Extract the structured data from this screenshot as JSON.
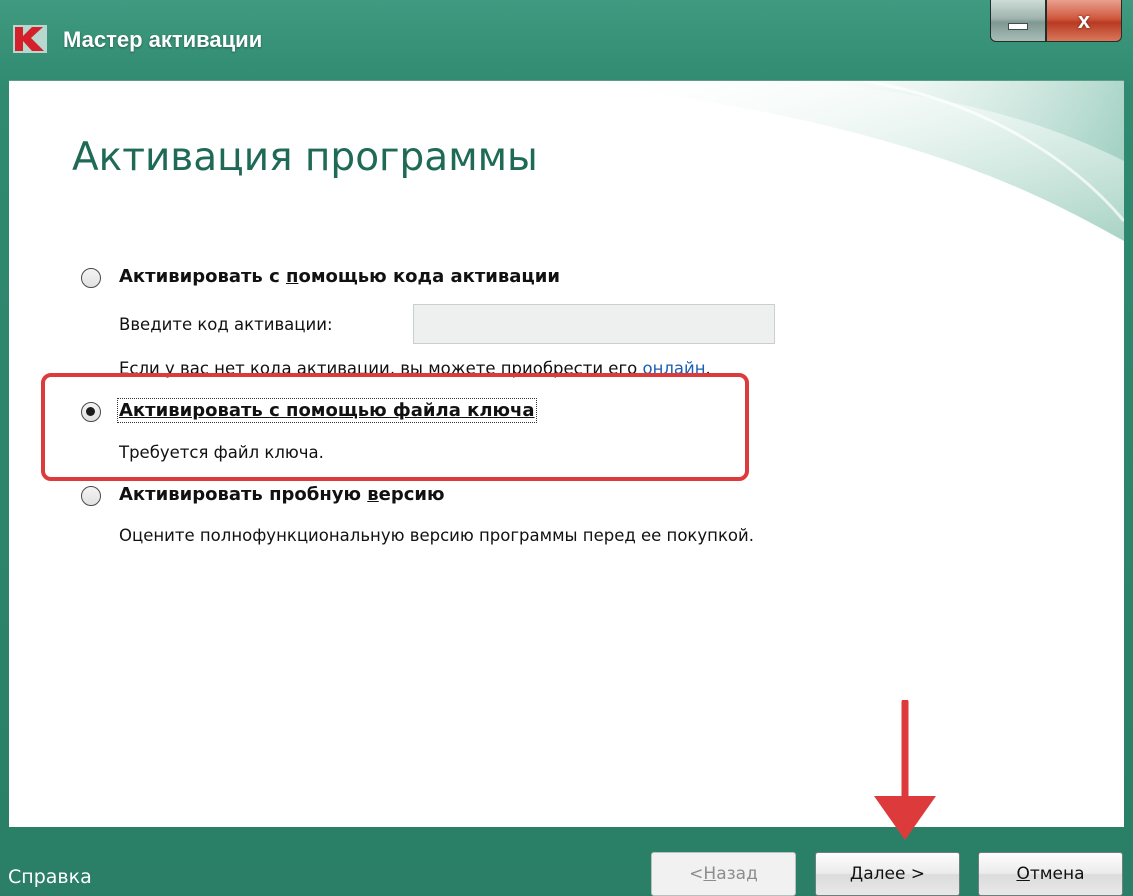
{
  "window": {
    "title": "Мастер активации",
    "minimize_icon": "minimize-icon",
    "close_label": "x"
  },
  "page": {
    "title": "Активация программы"
  },
  "options": [
    {
      "label_pre": "Активировать с ",
      "label_ul": "п",
      "label_post": "омощью кода активации",
      "checked": false
    },
    {
      "label": "Активировать с помощью файла ключа",
      "checked": true,
      "description": "Требуется файл ключа."
    },
    {
      "label_pre": "Активировать пробную ",
      "label_ul": "в",
      "label_post": "ерсию",
      "checked": false,
      "description": "Оцените полнофункциональную версию программы перед ее покупкой."
    }
  ],
  "activation_code": {
    "label": "Введите код активации:",
    "value": "",
    "hint_pre": "Если у вас нет кода активации, вы можете приобрести его ",
    "hint_link": "онлайн",
    "hint_post": "."
  },
  "footer": {
    "help": "Справка",
    "back_pre": "< ",
    "back_ul": "Н",
    "back_post": "азад",
    "next_pre": "Д",
    "next_rest": "алее >",
    "cancel_pre": "О",
    "cancel_rest": "тмена"
  },
  "colors": {
    "frame": "#2a7f66",
    "title_green": "#1f6a56",
    "highlight_red": "#dd3b3b",
    "link_blue": "#1a5fb4"
  }
}
